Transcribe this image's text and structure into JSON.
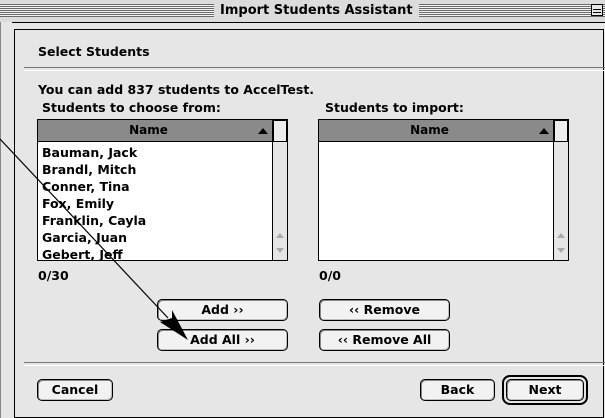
{
  "window": {
    "title": "Import Students Assistant"
  },
  "section_title": "Select Students",
  "info_text": "You can add 837 students to AccelTest.",
  "source_list": {
    "label": "Students to choose from:",
    "column_header": "Name",
    "rows": [
      "Bauman, Jack",
      "Brandl, Mitch",
      "Conner, Tina",
      "Fox, Emily",
      "Franklin, Cayla",
      "Garcia, Juan",
      "Gebert, Jeff"
    ],
    "count": "0/30"
  },
  "target_list": {
    "label": "Students to import:",
    "column_header": "Name",
    "rows": [],
    "count": "0/0"
  },
  "buttons": {
    "add": "Add ››",
    "add_all": "Add All ››",
    "remove": "‹‹ Remove",
    "remove_all": "‹‹ Remove All",
    "cancel": "Cancel",
    "back": "Back",
    "next": "Next"
  },
  "icons": {
    "sort": "sort-ascending-icon",
    "collapse": "window-collapse-icon",
    "cursor": "arrow-cursor-icon"
  }
}
